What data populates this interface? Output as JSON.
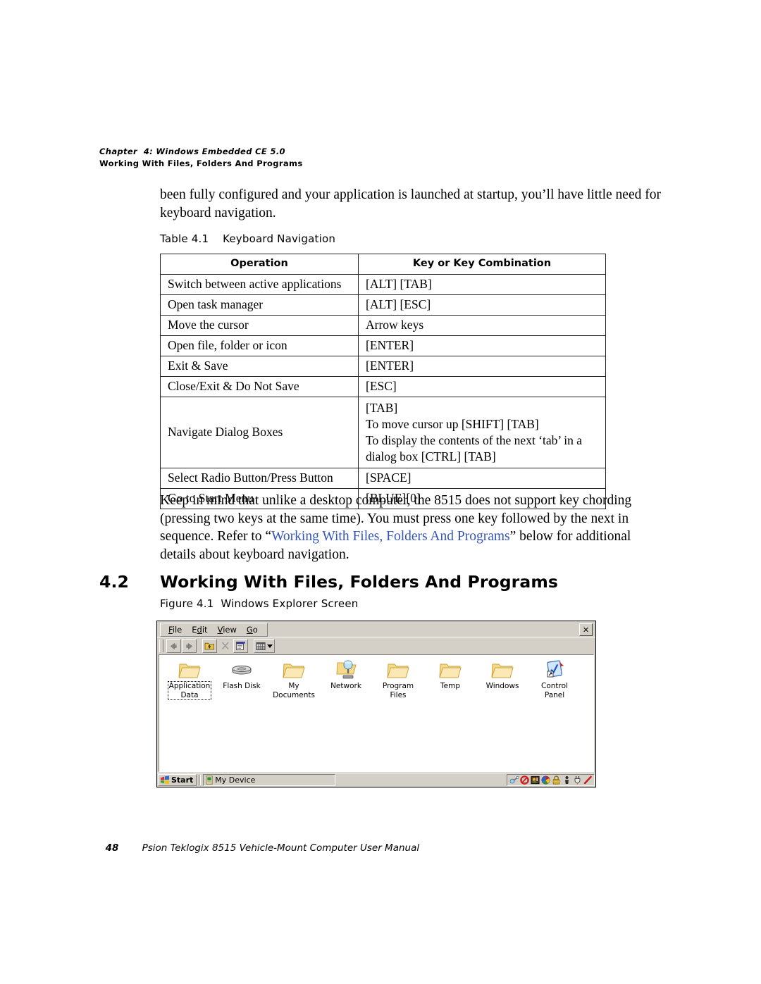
{
  "header": {
    "chapter_line": "Chapter  4: Windows Embedded CE 5.0",
    "section_line": "Working With Files, Folders And Programs"
  },
  "intro_paragraph": "been fully configured and your application is launched at startup, you’ll have little need for keyboard navigation.",
  "table": {
    "caption": "Table 4.1    Keyboard Navigation",
    "columns": [
      "Operation",
      "Key or Key Combination"
    ],
    "rows": [
      {
        "operation": "Switch between active applications",
        "keys": [
          "[ALT] [TAB]"
        ]
      },
      {
        "operation": "Open task manager",
        "keys": [
          "[ALT] [ESC]"
        ]
      },
      {
        "operation": "Move the cursor",
        "keys": [
          "Arrow keys"
        ]
      },
      {
        "operation": "Open file, folder or icon",
        "keys": [
          "[ENTER]"
        ]
      },
      {
        "operation": "Exit & Save",
        "keys": [
          "[ENTER]"
        ]
      },
      {
        "operation": "Close/Exit & Do Not Save",
        "keys": [
          "[ESC]"
        ]
      },
      {
        "operation": "Navigate Dialog Boxes",
        "keys": [
          "[TAB]",
          "To move cursor up [SHIFT] [TAB]",
          "To display the contents of the next ‘tab’ in a",
          "dialog box [CTRL] [TAB]"
        ]
      },
      {
        "operation": "Select Radio Button/Press Button",
        "keys": [
          "[SPACE]"
        ]
      },
      {
        "operation": "Go to Start Menu",
        "keys": [
          "[BLUE][0]"
        ]
      }
    ]
  },
  "note_paragraph": {
    "part1": "Keep in mind that unlike a desktop computer, the 8515 does not support key chording (pressing two keys at the same time). You must press one key followed by the next in sequence. Refer to “",
    "link": "Working With Files, Folders And Programs",
    "part2": "” below for additional details about keyboard navigation."
  },
  "section": {
    "number": "4.2",
    "title": "Working With Files, Folders And Programs",
    "figure_caption": "Figure 4.1  Windows Explorer Screen"
  },
  "explorer": {
    "menu": [
      {
        "pre": "",
        "accel": "F",
        "post": "ile"
      },
      {
        "pre": "E",
        "accel": "d",
        "post": "it"
      },
      {
        "pre": "",
        "accel": "V",
        "post": "iew"
      },
      {
        "pre": "",
        "accel": "G",
        "post": "o"
      }
    ],
    "close_label": "✕",
    "toolbar": [
      "back-arrow-icon",
      "forward-arrow-icon",
      "up-one-level-icon",
      "cut-icon",
      "properties-icon",
      "view-list-icon"
    ],
    "icons": [
      {
        "label": "Application\nData",
        "type": "folder",
        "selected": true
      },
      {
        "label": "Flash Disk",
        "type": "drive",
        "selected": false
      },
      {
        "label": "My\nDocuments",
        "type": "folder",
        "selected": false
      },
      {
        "label": "Network",
        "type": "network",
        "selected": false
      },
      {
        "label": "Program\nFiles",
        "type": "folder",
        "selected": false
      },
      {
        "label": "Temp",
        "type": "folder",
        "selected": false
      },
      {
        "label": "Windows",
        "type": "folder",
        "selected": false
      },
      {
        "label": "Control\nPanel",
        "type": "controlpanel",
        "selected": false
      }
    ],
    "taskbar": {
      "start_label": "Start",
      "task_label": "My Device",
      "tray_icons": [
        "antenna-icon",
        "network-disconnected-icon",
        "scanner-icon",
        "color-wheel-icon",
        "padlock-icon",
        "person-icon",
        "power-plug-icon",
        "stylus-pen-icon"
      ]
    }
  },
  "footer": {
    "page_number": "48",
    "manual_title": "Psion Teklogix 8515 Vehicle-Mount Computer User Manual"
  },
  "colors": {
    "link": "#3355bb",
    "chrome": "#d4d0c8",
    "folder": "#f5cf74",
    "client_bg": "#ffffff"
  }
}
